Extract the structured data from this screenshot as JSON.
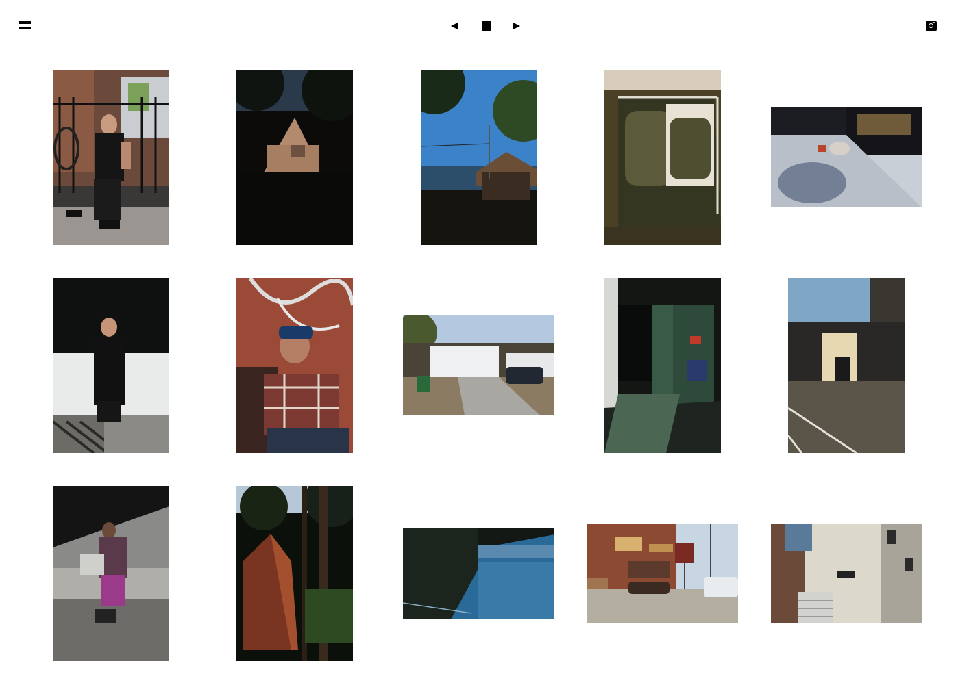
{
  "header": {
    "menu_icon": "hamburger-menu-icon",
    "slideshow": {
      "prev_icon": "previous-arrow-icon",
      "stop_icon": "stop-square-icon",
      "next_icon": "next-arrow-icon"
    },
    "social_icon": "instagram-icon"
  },
  "gallery": {
    "count": 15
  }
}
